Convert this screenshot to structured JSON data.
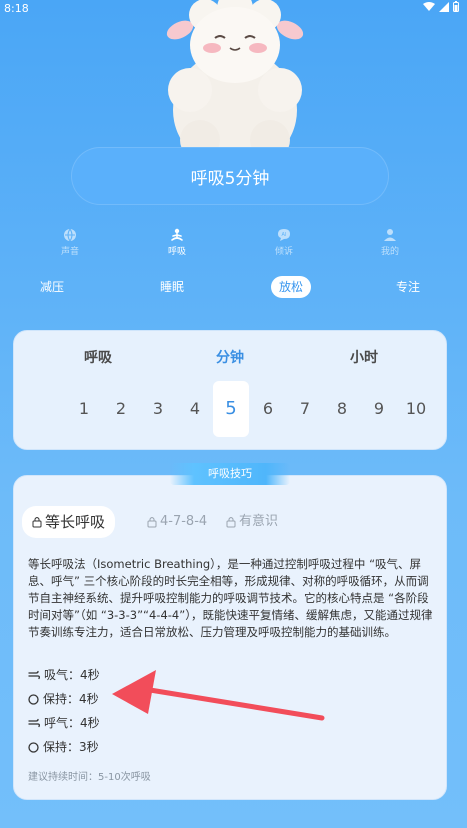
{
  "status_bar": {
    "time": "8:18"
  },
  "session_button": {
    "label": "呼吸5分钟"
  },
  "nav": [
    {
      "label": "声音",
      "icon": "globe-icon"
    },
    {
      "label": "呼吸",
      "icon": "meditation-icon",
      "active": true
    },
    {
      "label": "倾诉",
      "icon": "ai-chat-icon"
    },
    {
      "label": "我的",
      "icon": "person-icon"
    }
  ],
  "categories": [
    {
      "label": "减压"
    },
    {
      "label": "睡眠"
    },
    {
      "label": "放松",
      "active": true
    },
    {
      "label": "专注"
    }
  ],
  "picker": {
    "headers": {
      "left": "呼吸",
      "center": "分钟",
      "right": "小时"
    },
    "numbers": [
      "1",
      "2",
      "3",
      "4",
      "5",
      "6",
      "7",
      "8",
      "9",
      "10",
      "1"
    ],
    "selected": "5"
  },
  "technique": {
    "section_label": "呼吸技巧",
    "tabs": [
      {
        "label": "等长呼吸",
        "active": true
      },
      {
        "label": "4-7-8-4"
      },
      {
        "label": "有意识"
      }
    ],
    "description": "等长呼吸法（Isometric Breathing），是一种通过控制呼吸过程中 “吸气、屏息、呼气” 三个核心阶段的时长完全相等，形成规律、对称的呼吸循环，从而调节自主神经系统、提升呼吸控制能力的呼吸调节技术。它的核心特点是 “各阶段时间对等”（如 “3-3-3”“4-4-4”），既能快速平复情绪、缓解焦虑，又能通过规律节奏训练专注力，适合日常放松、压力管理及呼吸控制能力的基础训练。",
    "steps": [
      {
        "icon": "wind-icon",
        "text": "吸气：4秒"
      },
      {
        "icon": "circle-icon",
        "text": "保持：4秒"
      },
      {
        "icon": "wind-icon",
        "text": "呼气：4秒"
      },
      {
        "icon": "circle-icon",
        "text": "保持：3秒"
      }
    ],
    "hint": "建议持续时间：5-10次呼吸"
  },
  "colors": {
    "accent": "#3a8fe3",
    "arrow": "#f24d5a",
    "background": "#5eb2f8"
  }
}
